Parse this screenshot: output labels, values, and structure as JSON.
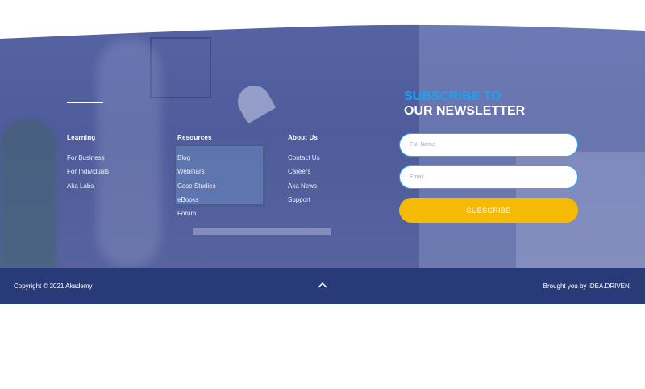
{
  "newsletter": {
    "title_line1": "SUBSCRIBE TO",
    "title_line2": "OUR NEWSLETTER",
    "full_name_placeholder": "Full Name",
    "email_placeholder": "Email",
    "subscribe_label": "SUBSCRIBE"
  },
  "columns": [
    {
      "heading": "Learning",
      "links": [
        "For Business",
        "For Individuals",
        "Aka Labs"
      ]
    },
    {
      "heading": "Resources",
      "links": [
        "Blog",
        "Webinars",
        "Case Studies",
        "eBooks",
        "Forum"
      ]
    },
    {
      "heading": "About Us",
      "links": [
        "Contact Us",
        "Careers",
        "Aka News",
        "Support"
      ]
    }
  ],
  "bottom_bar": {
    "copyright": "Copyright © 2021 Akademy",
    "credit": "Brought you by IDEA.DRIVEN.",
    "back_to_top_icon": "chevron-up-icon"
  },
  "colors": {
    "overlay": "#5563a4",
    "bottom_bar": "#293a78",
    "accent_blue": "#1fa0f0",
    "button_yellow": "#f5ba06"
  }
}
